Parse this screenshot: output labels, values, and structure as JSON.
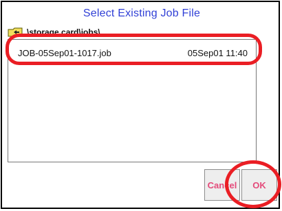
{
  "dialog": {
    "title": "Select Existing Job File",
    "path": "\\storage card\\jobs\\"
  },
  "files": [
    {
      "name": "JOB-05Sep01-1017.job",
      "date": "05Sep01 11:40"
    }
  ],
  "buttons": {
    "cancel_label": "Cancel",
    "ok_label": "OK"
  },
  "icons": {
    "folder_up": "folder-up-icon"
  },
  "colors": {
    "title": "#2f3fd6",
    "highlight": "#ea1e24",
    "button_text": "#e44a7a"
  }
}
